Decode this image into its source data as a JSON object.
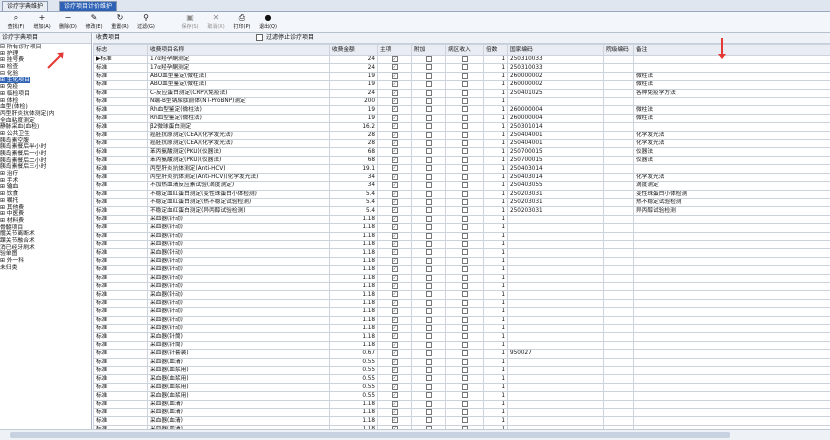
{
  "tabs": [
    {
      "label": "诊疗字典维护"
    },
    {
      "label": "诊疗项目计价维护"
    }
  ],
  "toolbar": [
    {
      "icon": "search-icon",
      "label": "查找(F)"
    },
    {
      "icon": "add-icon",
      "label": "增加(A)"
    },
    {
      "icon": "delete-icon",
      "label": "删除(D)"
    },
    {
      "icon": "edit-icon",
      "label": "修改(E)"
    },
    {
      "icon": "refresh-icon",
      "label": "重置(R)"
    },
    {
      "icon": "filter-icon",
      "label": "过滤(G)"
    },
    {
      "icon": "save-icon",
      "label": "保存(S)"
    },
    {
      "icon": "cancel-icon",
      "label": "取消(X)"
    },
    {
      "icon": "print-icon",
      "label": "打印(P)"
    },
    {
      "icon": "exit-icon",
      "label": "退出(Q)"
    }
  ],
  "left": {
    "header": "诊疗字典项目",
    "tree": [
      "⊟ 所有诊疗项目",
      "  ⊞ 护理",
      "  ⊞ 挂号费",
      "  ⊞ 检查",
      "  ⊟ 化验",
      "    ⊞ 生化项目",
      "    ⊞ 免疫",
      "    ⊞ 临检项目",
      "    ⊞ 体检",
      "      血型(体检)",
      "      丙型肝炎抗体测定(内",
      "      全血粘度测定",
      "      静脉采血(血检)",
      "    ⊞ 公共卫生",
      "      胰岛素空腹",
      "      胰岛素餐后半小时",
      "      胰岛素餐后一小时",
      "      胰岛素餐后二小时",
      "      胰岛素餐后三小时",
      "  ⊞ 治疗",
      "  ⊞ 手术",
      "  ⊞ 输血",
      "  ⊞ 饮食",
      "  ⊞ 嘱托",
      "  ⊞ 其他费",
      "  ⊞ 中医费",
      "  ⊞ 材料费",
      "    骨髓项目",
      "    髋关节离断术",
      "    踝关节融合术",
      "    消已经牙刷术",
      "    验单图",
      "  ⊞ 外一科",
      "    未归类"
    ]
  },
  "right": {
    "header": "收费项目",
    "filter_label": "过滤停止诊疗项目",
    "columns": [
      "标志",
      "收费项目名称",
      "收费金额",
      "主项",
      "附加",
      "病区收入",
      "倍数",
      "国家编码",
      "院级编码",
      "备注"
    ],
    "rows": [
      [
        "标准",
        "17α羟孕酮测定",
        "24",
        "✓",
        "",
        "",
        "1",
        "250310033",
        "",
        ""
      ],
      [
        "标准",
        "17α羟孕酮测定",
        "24",
        "✓",
        "",
        "",
        "1",
        "250310033",
        "",
        ""
      ],
      [
        "标准",
        "ABO血型鉴定(微柱法)",
        "19",
        "✓",
        "",
        "",
        "1",
        "260000002",
        "",
        "微柱法"
      ],
      [
        "标准",
        "ABO血型鉴定(微柱法)",
        "19",
        "✓",
        "",
        "",
        "1",
        "260000002",
        "",
        "微柱法"
      ],
      [
        "标准",
        "C-反应蛋白测定(CRP)(免疫法)",
        "24",
        "✓",
        "",
        "",
        "1",
        "250401025",
        "",
        "各种免疫学方法"
      ],
      [
        "标准",
        "N端-B型钠尿肽前体(NT-ProBNP)测定",
        "200",
        "✓",
        "",
        "",
        "1",
        "",
        "",
        ""
      ],
      [
        "标准",
        "Rh血型鉴定(微柱法)",
        "19",
        "✓",
        "",
        "",
        "1",
        "260000004",
        "",
        "微柱法"
      ],
      [
        "标准",
        "Rh血型鉴定(微柱法)",
        "19",
        "✓",
        "",
        "",
        "1",
        "260000004",
        "",
        "微柱法"
      ],
      [
        "标准",
        "β2微球蛋白测定",
        "16.2",
        "✓",
        "",
        "",
        "1",
        "250301014",
        "",
        ""
      ],
      [
        "标准",
        "癌胚抗原测定(CEA)(化学发光法)",
        "28",
        "✓",
        "",
        "",
        "1",
        "250404001",
        "",
        "化学发光法"
      ],
      [
        "标准",
        "癌胚抗原测定(CEA)(化学发光法)",
        "28",
        "✓",
        "",
        "",
        "1",
        "250404001",
        "",
        "化学发光法"
      ],
      [
        "标准",
        "苯丙氨酸测定(PKU)(仪器法)",
        "68",
        "✓",
        "",
        "",
        "1",
        "250700015",
        "",
        "仪器法"
      ],
      [
        "标准",
        "苯丙氨酸测定(PKU)(仪器法)",
        "68",
        "✓",
        "",
        "",
        "1",
        "250700015",
        "",
        "仪器法"
      ],
      [
        "标准",
        "丙型肝炎抗体测定(Anti-HCV)",
        "19.1",
        "✓",
        "",
        "",
        "1",
        "250403014",
        "",
        ""
      ],
      [
        "标准",
        "丙型肝炎抗体测定(Anti-HCV)(化学发光法)",
        "34",
        "✓",
        "",
        "",
        "1",
        "250403014",
        "",
        "化学发光法"
      ],
      [
        "标准",
        "不加热血清反应素试验(滴度测定)",
        "34",
        "✓",
        "",
        "",
        "1",
        "250403055",
        "",
        "滴度测定"
      ],
      [
        "标准",
        "不稳定血红蛋白测定(变性珠蛋白小体检测)",
        "5.4",
        "✓",
        "",
        "",
        "1",
        "250203031",
        "",
        "变性珠蛋白小体检测"
      ],
      [
        "标准",
        "不稳定血红蛋白测定(热不稳定试验检测)",
        "5.4",
        "✓",
        "",
        "",
        "1",
        "250203031",
        "",
        "热不稳定试验检测"
      ],
      [
        "标准",
        "不稳定血红蛋白测定(异丙醇试验检测)",
        "5.4",
        "✓",
        "",
        "",
        "1",
        "250203031",
        "",
        "异丙醇试验检测"
      ],
      [
        "标准",
        "采血器(针动)",
        "1.18",
        "✓",
        "",
        "",
        "1",
        "",
        "",
        ""
      ],
      [
        "标准",
        "采血器(针动)",
        "1.18",
        "✓",
        "",
        "",
        "1",
        "",
        "",
        ""
      ],
      [
        "标准",
        "采血器(针动)",
        "1.18",
        "✓",
        "",
        "",
        "1",
        "",
        "",
        ""
      ],
      [
        "标准",
        "采血器(针动)",
        "1.18",
        "✓",
        "",
        "",
        "1",
        "",
        "",
        ""
      ],
      [
        "标准",
        "采血器(针动)",
        "1.18",
        "✓",
        "",
        "",
        "1",
        "",
        "",
        ""
      ],
      [
        "标准",
        "采血器(针动)",
        "1.18",
        "✓",
        "",
        "",
        "1",
        "",
        "",
        ""
      ],
      [
        "标准",
        "采血器(针动)",
        "1.18",
        "✓",
        "",
        "",
        "1",
        "",
        "",
        ""
      ],
      [
        "标准",
        "采血器(针动)",
        "1.18",
        "✓",
        "",
        "",
        "1",
        "",
        "",
        ""
      ],
      [
        "标准",
        "采血器(针动)",
        "1.18",
        "✓",
        "",
        "",
        "1",
        "",
        "",
        ""
      ],
      [
        "标准",
        "采血器(针动)",
        "1.18",
        "✓",
        "",
        "",
        "1",
        "",
        "",
        ""
      ],
      [
        "标准",
        "采血器(针动)",
        "1.18",
        "✓",
        "",
        "",
        "1",
        "",
        "",
        ""
      ],
      [
        "标准",
        "采血器(针动)",
        "1.18",
        "✓",
        "",
        "",
        "1",
        "",
        "",
        ""
      ],
      [
        "标准",
        "采血器(针动)",
        "1.18",
        "✓",
        "",
        "",
        "1",
        "",
        "",
        ""
      ],
      [
        "标准",
        "采血器(针动)",
        "1.18",
        "✓",
        "",
        "",
        "1",
        "",
        "",
        ""
      ],
      [
        "标准",
        "采血器(针筒)",
        "1.18",
        "✓",
        "",
        "",
        "1",
        "",
        "",
        ""
      ],
      [
        "标准",
        "采血器(针筒)",
        "1.18",
        "✓",
        "",
        "",
        "1",
        "",
        "",
        ""
      ],
      [
        "标准",
        "采血器(针套装)",
        "0.67",
        "✓",
        "",
        "",
        "1",
        "950027",
        "",
        ""
      ],
      [
        "标准",
        "采血器(血清)",
        "0.55",
        "✓",
        "",
        "",
        "1",
        "",
        "",
        ""
      ],
      [
        "标准",
        "采血器(血浆用)",
        "0.55",
        "✓",
        "",
        "",
        "1",
        "",
        "",
        ""
      ],
      [
        "标准",
        "采血器(血浆用)",
        "0.55",
        "✓",
        "",
        "",
        "1",
        "",
        "",
        ""
      ],
      [
        "标准",
        "采血器(血浆用)",
        "0.55",
        "✓",
        "",
        "",
        "1",
        "",
        "",
        ""
      ],
      [
        "标准",
        "采血器(血浆用)",
        "0.55",
        "✓",
        "",
        "",
        "1",
        "",
        "",
        ""
      ],
      [
        "标准",
        "采血器(血清)",
        "1.18",
        "✓",
        "",
        "",
        "1",
        "",
        "",
        ""
      ],
      [
        "标准",
        "采血器(血清)",
        "1.18",
        "✓",
        "",
        "",
        "1",
        "",
        "",
        ""
      ],
      [
        "标准",
        "采血器(血清)",
        "1.18",
        "✓",
        "",
        "",
        "1",
        "",
        "",
        ""
      ],
      [
        "标准",
        "采血器(血清)",
        "1.18",
        "✓",
        "",
        "",
        "1",
        "",
        "",
        ""
      ]
    ]
  },
  "colors": {
    "accent": "#2f62b5",
    "annotation": "#e53935"
  }
}
